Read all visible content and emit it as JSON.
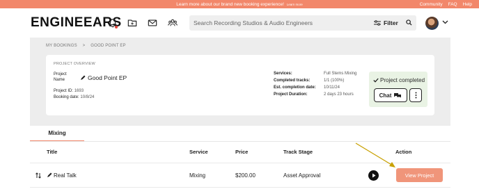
{
  "banner": {
    "message": "Learn more about our brand new booking experience!",
    "learn_more": "Learn more",
    "links": [
      "Community",
      "FAQ",
      "Help"
    ]
  },
  "header": {
    "logo": "ENGINEEARS",
    "search_placeholder": "Search Recording Studios & Audio Engineers",
    "filter_label": "Filter",
    "icons": [
      "bell-icon",
      "folder-icon",
      "mail-icon",
      "people-icon",
      "search-icon",
      "chevron-down-icon"
    ]
  },
  "breadcrumb": {
    "items": [
      "MY BOOKINGS",
      ">",
      "GOOD POINT EP"
    ]
  },
  "overview": {
    "title": "PROJECT OVERVIEW",
    "project_name_label": "Project Name",
    "project_name": "Good Point EP",
    "project_id_label": "Project ID:",
    "project_id": "1693",
    "booking_date_label": "Booking date:",
    "booking_date": "10/8/24",
    "services_label": "Services:",
    "services": "Full Stems Mixing",
    "completed_tracks_label": "Completed tracks:",
    "completed_tracks": "1/1 (100%)",
    "est_completion_label": "Est. completion date:",
    "est_completion": "10/11/24",
    "duration_label": "Project Duration:",
    "duration": "2 days 23 hours",
    "status": "Project completed",
    "chat_label": "Chat"
  },
  "tabs": [
    {
      "label": "Mixing",
      "active": true
    }
  ],
  "table": {
    "headers": [
      "Title",
      "Service",
      "Price",
      "Track Stage",
      "Action"
    ],
    "rows": [
      {
        "title": "Real Talk",
        "service": "Mixing",
        "price": "$200.00",
        "stage": "Asset Approval",
        "action": "View Project"
      }
    ]
  },
  "colors": {
    "accent": "#f2876a",
    "button": "#f0957a",
    "status_bg": "#e9f3e4",
    "panel_bg": "#ededed",
    "annotation_arrow": "#c8a000"
  }
}
